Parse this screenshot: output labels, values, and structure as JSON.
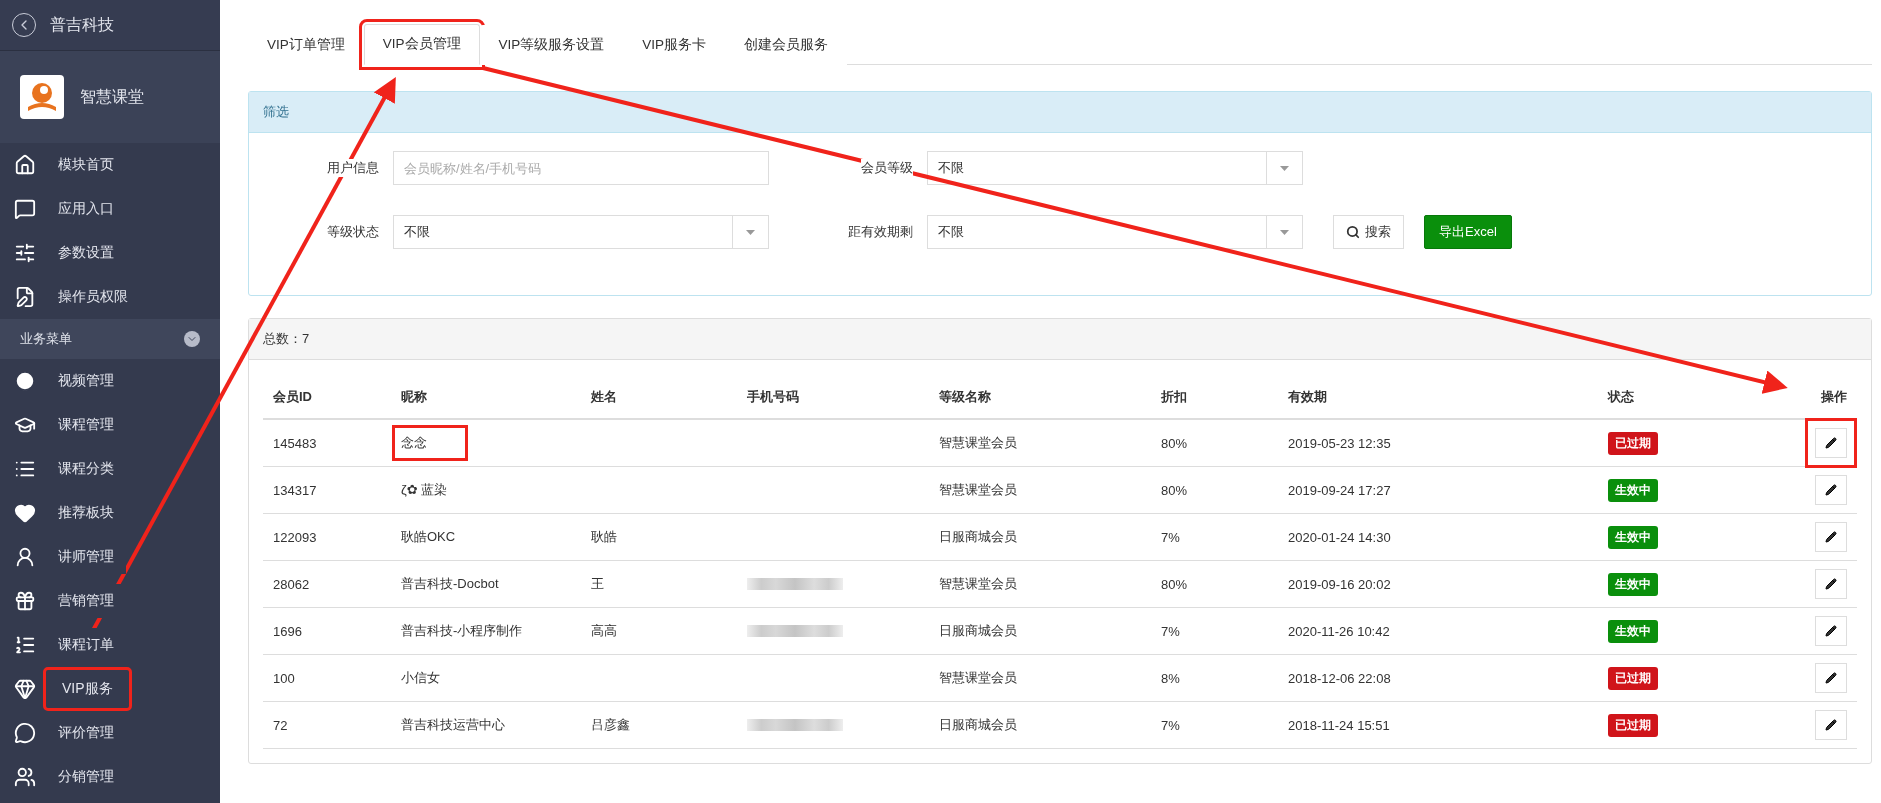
{
  "sidebar": {
    "back_title": "普吉科技",
    "app_name": "智慧课堂",
    "items": [
      {
        "label": "模块首页",
        "highlighted": false
      },
      {
        "label": "应用入口",
        "highlighted": false
      },
      {
        "label": "参数设置",
        "highlighted": false
      },
      {
        "label": "操作员权限",
        "highlighted": false
      }
    ],
    "section": {
      "label": "业务菜单",
      "expanded": true
    },
    "section_items": [
      {
        "label": "视频管理",
        "highlighted": false
      },
      {
        "label": "课程管理",
        "highlighted": false
      },
      {
        "label": "课程分类",
        "highlighted": false
      },
      {
        "label": "推荐板块",
        "highlighted": false
      },
      {
        "label": "讲师管理",
        "highlighted": false
      },
      {
        "label": "营销管理",
        "highlighted": false
      },
      {
        "label": "课程订单",
        "highlighted": false
      },
      {
        "label": "VIP服务",
        "highlighted": true
      },
      {
        "label": "评价管理",
        "highlighted": false
      },
      {
        "label": "分销管理",
        "highlighted": false
      }
    ]
  },
  "tabs": [
    {
      "label": "VIP订单管理",
      "selected": false,
      "highlighted": false
    },
    {
      "label": "VIP会员管理",
      "selected": true,
      "highlighted": true
    },
    {
      "label": "VIP等级服务设置",
      "selected": false,
      "highlighted": false
    },
    {
      "label": "VIP服务卡",
      "selected": false,
      "highlighted": false
    },
    {
      "label": "创建会员服务",
      "selected": false,
      "highlighted": false
    }
  ],
  "filter": {
    "title": "筛选",
    "fields": [
      {
        "label": "用户信息",
        "kind": "text",
        "placeholder": "会员昵称/姓名/手机号码"
      },
      {
        "label": "会员等级",
        "kind": "select",
        "value": "不限"
      },
      {
        "label": "等级状态",
        "kind": "select",
        "value": "不限"
      },
      {
        "label": "距有效期剩",
        "kind": "select",
        "value": "不限"
      }
    ],
    "search_button": "搜索",
    "export_button": "导出Excel"
  },
  "table": {
    "total": "总数：7",
    "columns": [
      "会员ID",
      "昵称",
      "姓名",
      "手机号码",
      "等级名称",
      "折扣",
      "有效期",
      "状态",
      "操作"
    ],
    "rows": [
      {
        "id": "145483",
        "nickname": "念念",
        "name": "",
        "phone_redacted": false,
        "level": "智慧课堂会员",
        "discount": "80%",
        "expiry": "2019-05-23 12:35",
        "status": {
          "label": "已过期",
          "kind": "expired"
        },
        "highlighted": true
      },
      {
        "id": "134317",
        "nickname": "ζ✿ 蓝染",
        "name": "",
        "phone_redacted": false,
        "level": "智慧课堂会员",
        "discount": "80%",
        "expiry": "2019-09-24 17:27",
        "status": {
          "label": "生效中",
          "kind": "active"
        },
        "highlighted": false
      },
      {
        "id": "122093",
        "nickname": "耿皓OKC",
        "name": "耿皓",
        "phone_redacted": false,
        "level": "日服商城会员",
        "discount": "7%",
        "expiry": "2020-01-24 14:30",
        "status": {
          "label": "生效中",
          "kind": "active"
        },
        "highlighted": false
      },
      {
        "id": "28062",
        "nickname": "普吉科技-Docbot",
        "name": "王",
        "phone_redacted": true,
        "level": "智慧课堂会员",
        "discount": "80%",
        "expiry": "2019-09-16 20:02",
        "status": {
          "label": "生效中",
          "kind": "active"
        },
        "highlighted": false
      },
      {
        "id": "1696",
        "nickname": "普吉科技-小程序制作",
        "name": "高高",
        "phone_redacted": true,
        "level": "日服商城会员",
        "discount": "7%",
        "expiry": "2020-11-26 10:42",
        "status": {
          "label": "生效中",
          "kind": "active"
        },
        "highlighted": false
      },
      {
        "id": "100",
        "nickname": "小信女",
        "name": "",
        "phone_redacted": false,
        "level": "智慧课堂会员",
        "discount": "8%",
        "expiry": "2018-12-06 22:08",
        "status": {
          "label": "已过期",
          "kind": "expired"
        },
        "highlighted": false
      },
      {
        "id": "72",
        "nickname": "普吉科技运营中心",
        "name": "吕彦鑫",
        "phone_redacted": true,
        "level": "日服商城会员",
        "discount": "7%",
        "expiry": "2018-11-24 15:51",
        "status": {
          "label": "已过期",
          "kind": "expired"
        },
        "highlighted": false
      }
    ]
  }
}
